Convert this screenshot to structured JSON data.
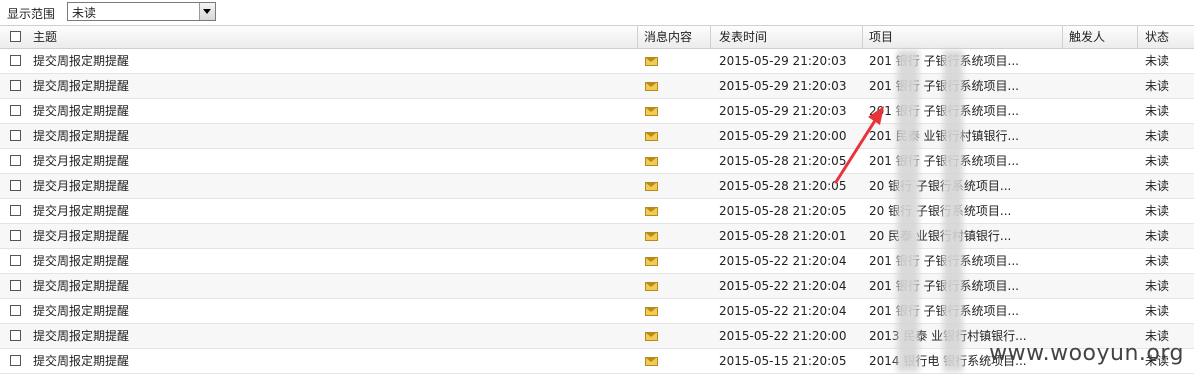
{
  "filter": {
    "label": "显示范围",
    "selected": "未读"
  },
  "columns": [
    "主题",
    "消息内容",
    "发表时间",
    "项目",
    "触发人",
    "状态"
  ],
  "rows": [
    {
      "subject": "提交周报定期提醒",
      "time": "2015-05-29 21:20:03",
      "project": "201    银行    子银行系统项目...",
      "status": "未读"
    },
    {
      "subject": "提交周报定期提醒",
      "time": "2015-05-29 21:20:03",
      "project": "201    银行    子银行系统项目...",
      "status": "未读"
    },
    {
      "subject": "提交周报定期提醒",
      "time": "2015-05-29 21:20:03",
      "project": "201    银行    子银行系统项目...",
      "status": "未读"
    },
    {
      "subject": "提交周报定期提醒",
      "time": "2015-05-29 21:20:00",
      "project": "201    民泰    业银行村镇银行...",
      "status": "未读"
    },
    {
      "subject": "提交月报定期提醒",
      "time": "2015-05-28 21:20:05",
      "project": "201    银行    子银行系统项目...",
      "status": "未读"
    },
    {
      "subject": "提交月报定期提醒",
      "time": "2015-05-28 21:20:05",
      "project": "20    银行    子银行系统项目...",
      "status": "未读"
    },
    {
      "subject": "提交月报定期提醒",
      "time": "2015-05-28 21:20:05",
      "project": "20    银行    子银行系统项目...",
      "status": "未读"
    },
    {
      "subject": "提交月报定期提醒",
      "time": "2015-05-28 21:20:01",
      "project": "20    民泰    业银行村镇银行...",
      "status": "未读"
    },
    {
      "subject": "提交周报定期提醒",
      "time": "2015-05-22 21:20:04",
      "project": "201    银行    子银行系统项目...",
      "status": "未读"
    },
    {
      "subject": "提交周报定期提醒",
      "time": "2015-05-22 21:20:04",
      "project": "201    银行    子银行系统项目...",
      "status": "未读"
    },
    {
      "subject": "提交周报定期提醒",
      "time": "2015-05-22 21:20:04",
      "project": "201    银行    子银行系统项目...",
      "status": "未读"
    },
    {
      "subject": "提交周报定期提醒",
      "time": "2015-05-22 21:20:00",
      "project": "2013    民泰    业银行村镇银行...",
      "status": "未读"
    },
    {
      "subject": "提交周报定期提醒",
      "time": "2015-05-15 21:20:05",
      "project": "2014    银行电    银行系统项目...",
      "status": "未读"
    }
  ],
  "watermark": "www.wooyun.org",
  "icons": {
    "checkbox": "checkbox-icon",
    "message": "envelope-icon",
    "dropdown": "chevron-down-icon",
    "annotation": "red-arrow-annotation"
  },
  "colors": {
    "annotation_arrow": "#e8333a",
    "envelope": "#f1cb55"
  }
}
